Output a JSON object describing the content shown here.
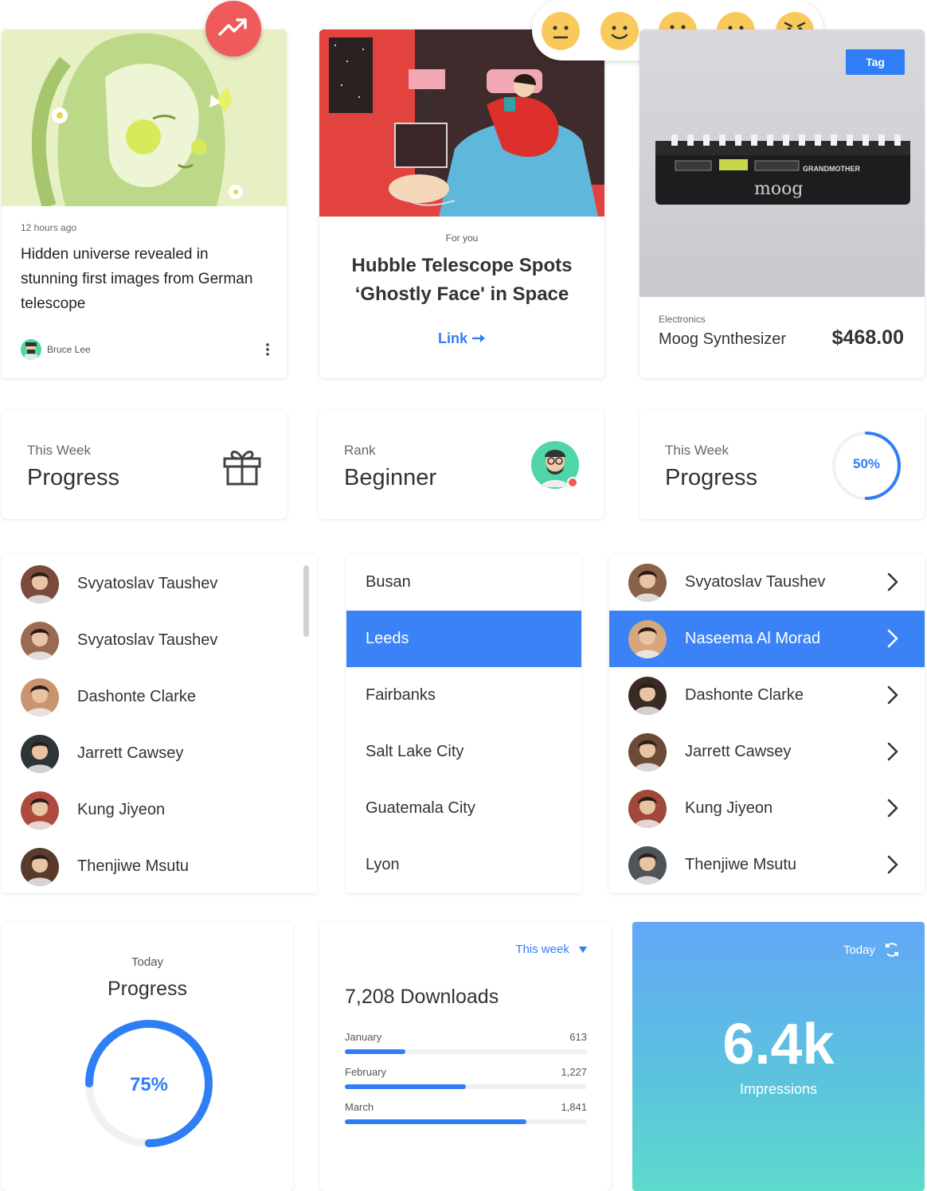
{
  "colors": {
    "accent": "#2f7ef5",
    "selected": "#3b82f6",
    "trend": "#ef5a5a",
    "emoji": "#f9c95c"
  },
  "article": {
    "time": "12 hours ago",
    "title": "Hidden universe revealed in stunning first images from German telescope",
    "author": "Bruce Lee"
  },
  "feature": {
    "label": "For you",
    "title_line1": "Hubble Telescope Spots",
    "title_line2": "‘Ghostly Face' in Space",
    "link": "Link"
  },
  "product": {
    "tag": "Tag",
    "category": "Electronics",
    "name": "Moog Synthesizer",
    "price": "$468.00",
    "brand_text": "moog",
    "model_text": "GRANDMOTHER"
  },
  "emoji_rating": [
    "neutral-face-icon",
    "smiling-face-icon",
    "surprised-face-icon",
    "sad-face-icon",
    "angry-face-icon"
  ],
  "stats": [
    {
      "label": "This Week",
      "value": "Progress",
      "icon": "gift-icon"
    },
    {
      "label": "Rank",
      "value": "Beginner",
      "icon": "avatar-icon"
    },
    {
      "label": "This Week",
      "value": "Progress",
      "percent": "50%",
      "fraction": 0.5
    }
  ],
  "people_list": [
    {
      "name": "Svyatoslav Taushev",
      "color": "#7a4b3a"
    },
    {
      "name": "Svyatoslav Taushev",
      "color": "#9a6a52"
    },
    {
      "name": "Dashonte Clarke",
      "color": "#c99470"
    },
    {
      "name": "Jarrett Cawsey",
      "color": "#2e3538"
    },
    {
      "name": "Kung Jiyeon",
      "color": "#b04a3e"
    },
    {
      "name": "Thenjiwe Msutu",
      "color": "#5a3a2a"
    }
  ],
  "cities": {
    "items": [
      "Busan",
      "Leeds",
      "Fairbanks",
      "Salt Lake City",
      "Guatemala City",
      "Lyon"
    ],
    "selected": 1
  },
  "people_nav": {
    "items": [
      {
        "name": "Svyatoslav Taushev",
        "color": "#8b6048"
      },
      {
        "name": "Naseema Al Morad",
        "color": "#d6a77f"
      },
      {
        "name": "Dashonte Clarke",
        "color": "#3a2a24"
      },
      {
        "name": "Jarrett Cawsey",
        "color": "#6b4a36"
      },
      {
        "name": "Kung Jiyeon",
        "color": "#a0483a"
      },
      {
        "name": "Thenjiwe Msutu",
        "color": "#4e5458"
      }
    ],
    "selected": 1
  },
  "today_progress": {
    "label": "Today",
    "title": "Progress",
    "percent": "75%",
    "fraction": 0.75
  },
  "downloads": {
    "filter": "This week",
    "title": "7,208 Downloads",
    "rows": [
      {
        "month": "January",
        "value": "613",
        "fraction": 0.25
      },
      {
        "month": "February",
        "value": "1,227",
        "fraction": 0.5
      },
      {
        "month": "March",
        "value": "1,841",
        "fraction": 0.75
      }
    ]
  },
  "impressions": {
    "label": "Today",
    "value": "6.4k",
    "caption": "Impressions"
  }
}
